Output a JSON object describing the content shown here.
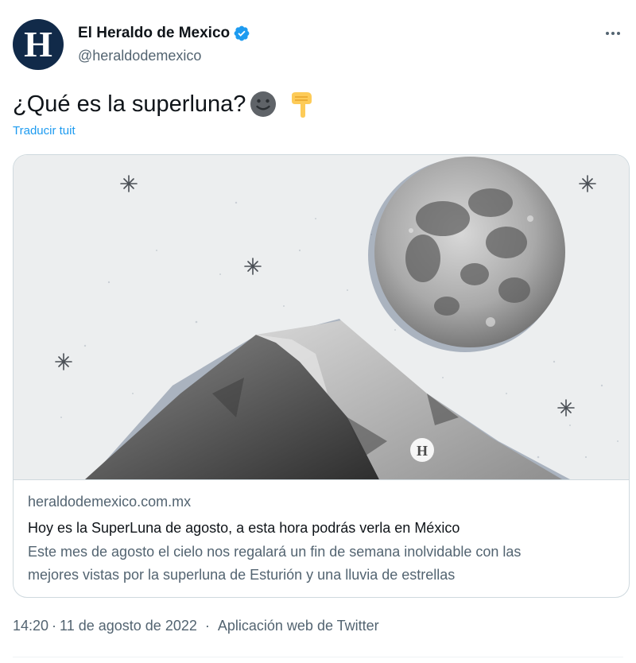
{
  "author": {
    "avatar_letter": "H",
    "name": "El Heraldo de Mexico",
    "handle": "@heraldodemexico",
    "verified_icon": "verified-badge-icon"
  },
  "tweet": {
    "text": "¿Qué es la superluna?",
    "emojis": [
      "slightly-smiling-face",
      "backhand-index-pointing-down"
    ],
    "translate_label": "Traducir tuit"
  },
  "card": {
    "watermark_letter": "H",
    "domain": "heraldodemexico.com.mx",
    "title": "Hoy es la SuperLuna de agosto, a esta hora podrás verla en México",
    "description_line1": "Este mes de agosto el cielo nos regalará un fin de semana inolvidable con las",
    "description_line2": "mejores vistas por la superluna de Esturión y una lluvia de estrellas"
  },
  "meta": {
    "time": "14:20",
    "separator": "·",
    "date": "11 de agosto de 2022",
    "source": "Aplicación web de Twitter"
  },
  "colors": {
    "link": "#1d9bf0",
    "secondary_text": "#536471",
    "avatar_bg": "#112a49"
  }
}
